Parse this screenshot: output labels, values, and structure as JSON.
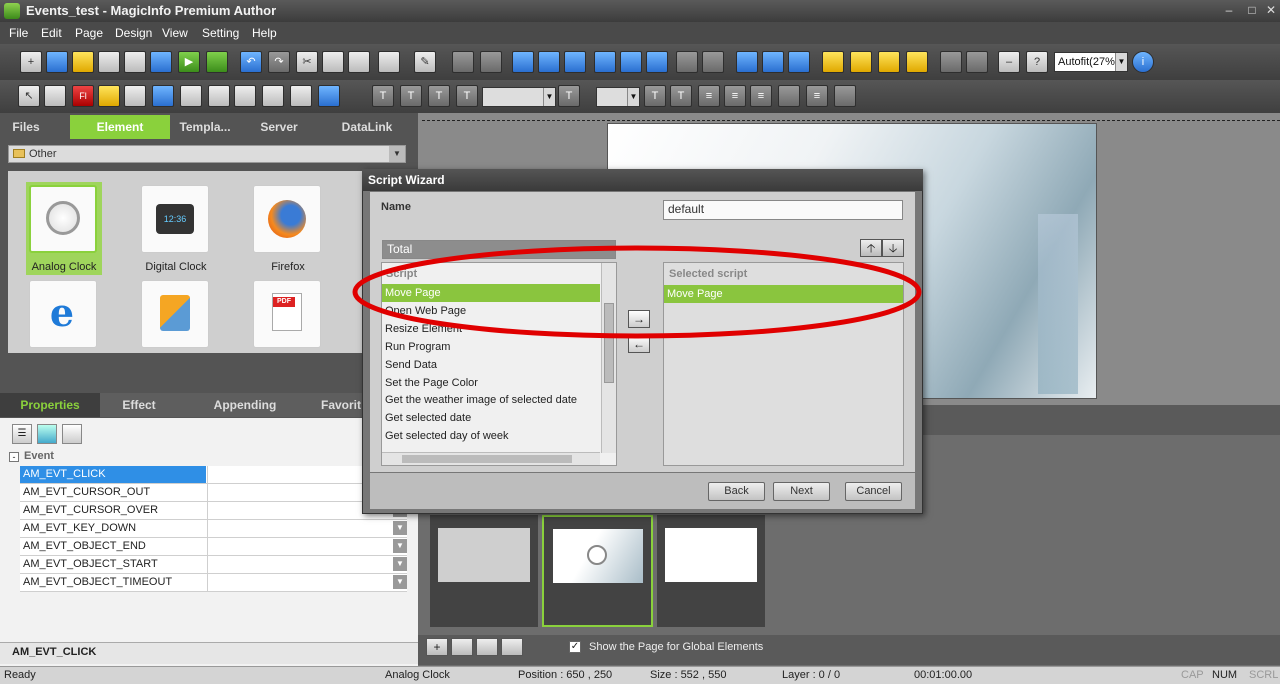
{
  "window": {
    "title": "Events_test - MagicInfo Premium Author"
  },
  "menu": [
    "File",
    "Edit",
    "Page",
    "Design",
    "View",
    "Setting",
    "Help"
  ],
  "toolbar": {
    "zoom_value": "Autofit(27%"
  },
  "left_tabs": [
    "Files",
    "Element",
    "Templa...",
    "Server",
    "DataLink"
  ],
  "element_category": "Other",
  "elements": [
    {
      "label": "Analog Clock",
      "icon": "analog-clock-icon"
    },
    {
      "label": "Digital Clock",
      "icon": "digital-clock-icon"
    },
    {
      "label": "Firefox",
      "icon": "firefox-icon"
    },
    {
      "label": "",
      "icon": "internet-explorer-icon"
    },
    {
      "label": "",
      "icon": "office-icon"
    },
    {
      "label": "",
      "icon": "pdf-icon"
    }
  ],
  "prop_tabs": [
    "Properties",
    "Effect",
    "Appending",
    "Favorit"
  ],
  "prop_group": "Event",
  "events": [
    "AM_EVT_CLICK",
    "AM_EVT_CURSOR_OUT",
    "AM_EVT_CURSOR_OVER",
    "AM_EVT_KEY_DOWN",
    "AM_EVT_OBJECT_END",
    "AM_EVT_OBJECT_START",
    "AM_EVT_OBJECT_TIMEOUT"
  ],
  "prop_footer": "AM_EVT_CLICK",
  "wizard": {
    "title": "Script Wizard",
    "name_label": "Name",
    "name_value": "default",
    "category": "Total",
    "script_header": "Script",
    "scripts": [
      "Move Page",
      "Open Web Page",
      "Resize Element",
      "Run Program",
      "Send Data",
      "Set the Page Color",
      "Get the weather image of selected date",
      "Get selected date",
      "Get selected day of week"
    ],
    "selected_header": "Selected script",
    "selected": [
      "Move Page"
    ],
    "back": "Back",
    "next": "Next",
    "cancel": "Cancel"
  },
  "page_options": {
    "show_global": "Show the Page for Global Elements"
  },
  "status": {
    "ready": "Ready",
    "element": "Analog Clock",
    "position": "Position : 650 , 250",
    "size": "Size : 552 , 550",
    "layer": "Layer : 0 / 0",
    "time": "00:01:00.00",
    "cap": "CAP",
    "num": "NUM",
    "scrl": "SCRL"
  },
  "colors": {
    "accent": "#8ad13c",
    "highlight": "#e00000"
  }
}
